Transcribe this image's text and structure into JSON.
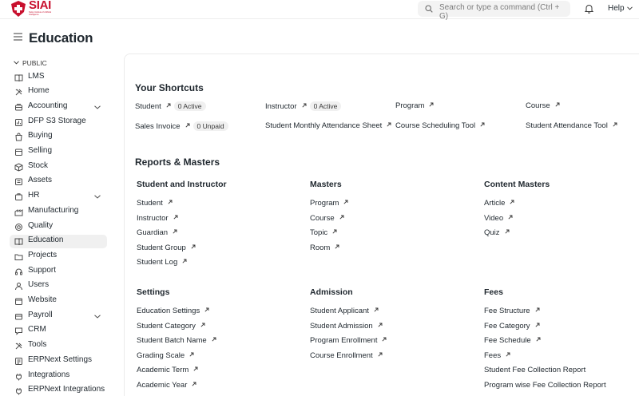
{
  "navbar": {
    "logo_text": "SIAI",
    "logo_sub": "Swiss Institute of Artificial Intelligence",
    "search_placeholder": "Search or type a command (Ctrl + G)",
    "help_label": "Help"
  },
  "page": {
    "title": "Education"
  },
  "sidebar": {
    "group_label": "PUBLIC",
    "items": [
      {
        "label": "LMS",
        "icon": "book-icon"
      },
      {
        "label": "Home",
        "icon": "tools-icon"
      },
      {
        "label": "Accounting",
        "icon": "accounting-icon",
        "expandable": true
      },
      {
        "label": "DFP S3 Storage",
        "icon": "chart-icon"
      },
      {
        "label": "Buying",
        "icon": "shopping-bag-icon"
      },
      {
        "label": "Selling",
        "icon": "cart-icon"
      },
      {
        "label": "Stock",
        "icon": "box-icon"
      },
      {
        "label": "Assets",
        "icon": "assets-icon"
      },
      {
        "label": "HR",
        "icon": "hr-icon",
        "expandable": true
      },
      {
        "label": "Manufacturing",
        "icon": "factory-icon"
      },
      {
        "label": "Quality",
        "icon": "quality-icon"
      },
      {
        "label": "Education",
        "icon": "book-icon",
        "active": true
      },
      {
        "label": "Projects",
        "icon": "folder-icon"
      },
      {
        "label": "Support",
        "icon": "support-icon"
      },
      {
        "label": "Users",
        "icon": "users-icon"
      },
      {
        "label": "Website",
        "icon": "website-icon"
      },
      {
        "label": "Payroll",
        "icon": "payroll-icon",
        "expandable": true
      },
      {
        "label": "CRM",
        "icon": "crm-icon"
      },
      {
        "label": "Tools",
        "icon": "tools-icon"
      },
      {
        "label": "ERPNext Settings",
        "icon": "settings-icon"
      },
      {
        "label": "Integrations",
        "icon": "integrations-icon"
      },
      {
        "label": "ERPNext Integrations",
        "icon": "integrations-icon"
      }
    ]
  },
  "shortcuts": {
    "title": "Your Shortcuts",
    "items": [
      {
        "label": "Student",
        "badge": "0 Active"
      },
      {
        "label": "Instructor",
        "badge": "0 Active"
      },
      {
        "label": "Program"
      },
      {
        "label": "Course"
      },
      {
        "label": "Sales Invoice",
        "badge": "0 Unpaid"
      },
      {
        "label": "Student Monthly Attendance Sheet"
      },
      {
        "label": "Course Scheduling Tool"
      },
      {
        "label": "Student Attendance Tool"
      }
    ]
  },
  "reports": {
    "title": "Reports & Masters",
    "cards": [
      {
        "title": "Student and Instructor",
        "links": [
          "Student",
          "Instructor",
          "Guardian",
          "Student Group",
          "Student Log"
        ]
      },
      {
        "title": "Masters",
        "links": [
          "Program",
          "Course",
          "Topic",
          "Room"
        ]
      },
      {
        "title": "Content Masters",
        "links": [
          "Article",
          "Video",
          "Quiz"
        ]
      },
      {
        "title": "Settings",
        "links": [
          "Education Settings",
          "Student Category",
          "Student Batch Name",
          "Grading Scale",
          "Academic Term",
          "Academic Year"
        ]
      },
      {
        "title": "Admission",
        "links": [
          "Student Applicant",
          "Student Admission",
          "Program Enrollment",
          "Course Enrollment"
        ]
      },
      {
        "title": "Fees",
        "links": [
          "Fee Structure",
          "Fee Category",
          "Fee Schedule",
          "Fees",
          "Student Fee Collection Report",
          "Program wise Fee Collection Report"
        ]
      }
    ]
  },
  "colors": {
    "brand": "#c8102e",
    "active_bg": "#f0f0f0"
  }
}
